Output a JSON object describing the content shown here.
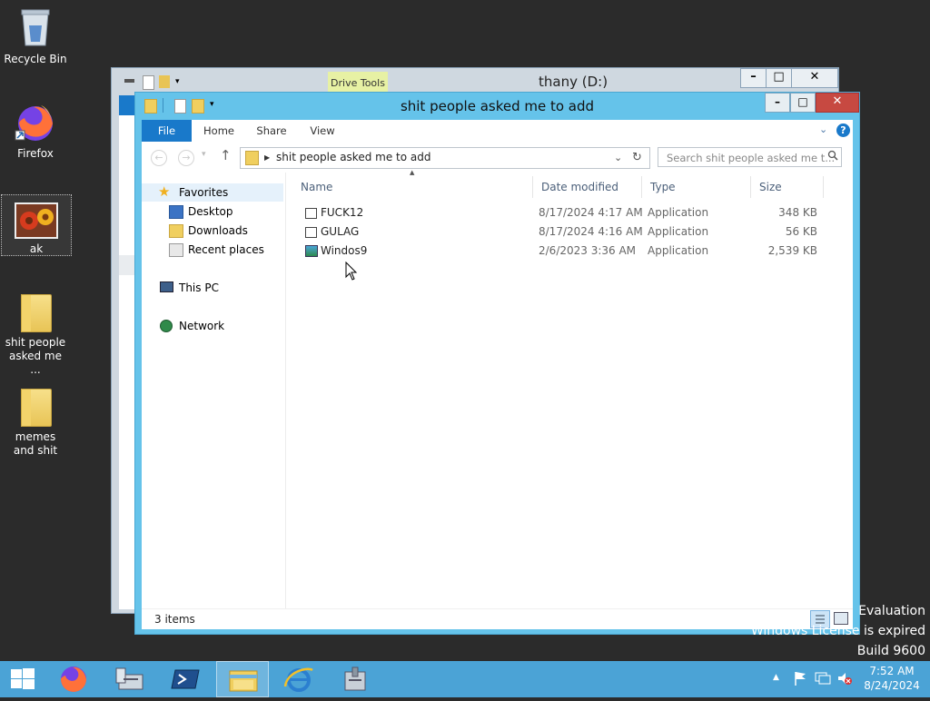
{
  "desktop": {
    "icons": [
      {
        "label": "Recycle Bin",
        "icon": "recycle-bin-icon"
      },
      {
        "label": "Firefox",
        "icon": "firefox-icon"
      },
      {
        "label": "ak",
        "icon": "image-file-icon"
      },
      {
        "label": "shit people asked me ...",
        "icon": "folder-icon"
      },
      {
        "label": "memes and shit",
        "icon": "folder-icon"
      }
    ]
  },
  "back_window": {
    "title": "thany (D:)",
    "context_tab": "Drive Tools"
  },
  "window": {
    "title": "shit people asked me to add",
    "ribbon_tabs": [
      "File",
      "Home",
      "Share",
      "View"
    ],
    "address": "shit people asked me to add",
    "search_placeholder": "Search shit people asked me t...",
    "nav": {
      "favorites": "Favorites",
      "favorites_items": [
        "Desktop",
        "Downloads",
        "Recent places"
      ],
      "this_pc": "This PC",
      "network": "Network"
    },
    "columns": [
      "Name",
      "Date modified",
      "Type",
      "Size"
    ],
    "files": [
      {
        "name": "FUCK12",
        "date": "8/17/2024 4:17 AM",
        "type": "Application",
        "size": "348 KB"
      },
      {
        "name": "GULAG",
        "date": "8/17/2024 4:16 AM",
        "type": "Application",
        "size": "56 KB"
      },
      {
        "name": "Windos9",
        "date": "2/6/2023 3:36 AM",
        "type": "Application",
        "size": "2,539 KB"
      }
    ],
    "status": "3 items"
  },
  "watermark": {
    "line1": "Evaluation",
    "line2": "Windows License is expired",
    "line3": "Build 9600"
  },
  "taskbar": {
    "time": "7:52 AM",
    "date": "8/24/2024"
  },
  "colors": {
    "accent": "#1979ca",
    "window_frame": "#65c3ea",
    "taskbar": "#4ba3d6",
    "close": "#c74941"
  }
}
